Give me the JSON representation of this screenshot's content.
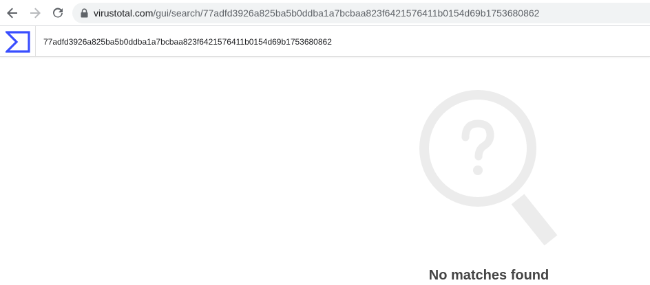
{
  "browser": {
    "url_domain": "virustotal.com",
    "url_path": "/gui/search/77adfd3926a825ba5b0ddba1a7bcbaa823f6421576411b0154d69b1753680862"
  },
  "header": {
    "search_value": "77adfd3926a825ba5b0ddba1a7bcbaa823f6421576411b0154d69b1753680862",
    "logo_icon": "virustotal-sigma-logo",
    "logo_color": "#394eff"
  },
  "results": {
    "empty_icon": "magnifier-question-icon",
    "message": "No matches found"
  }
}
